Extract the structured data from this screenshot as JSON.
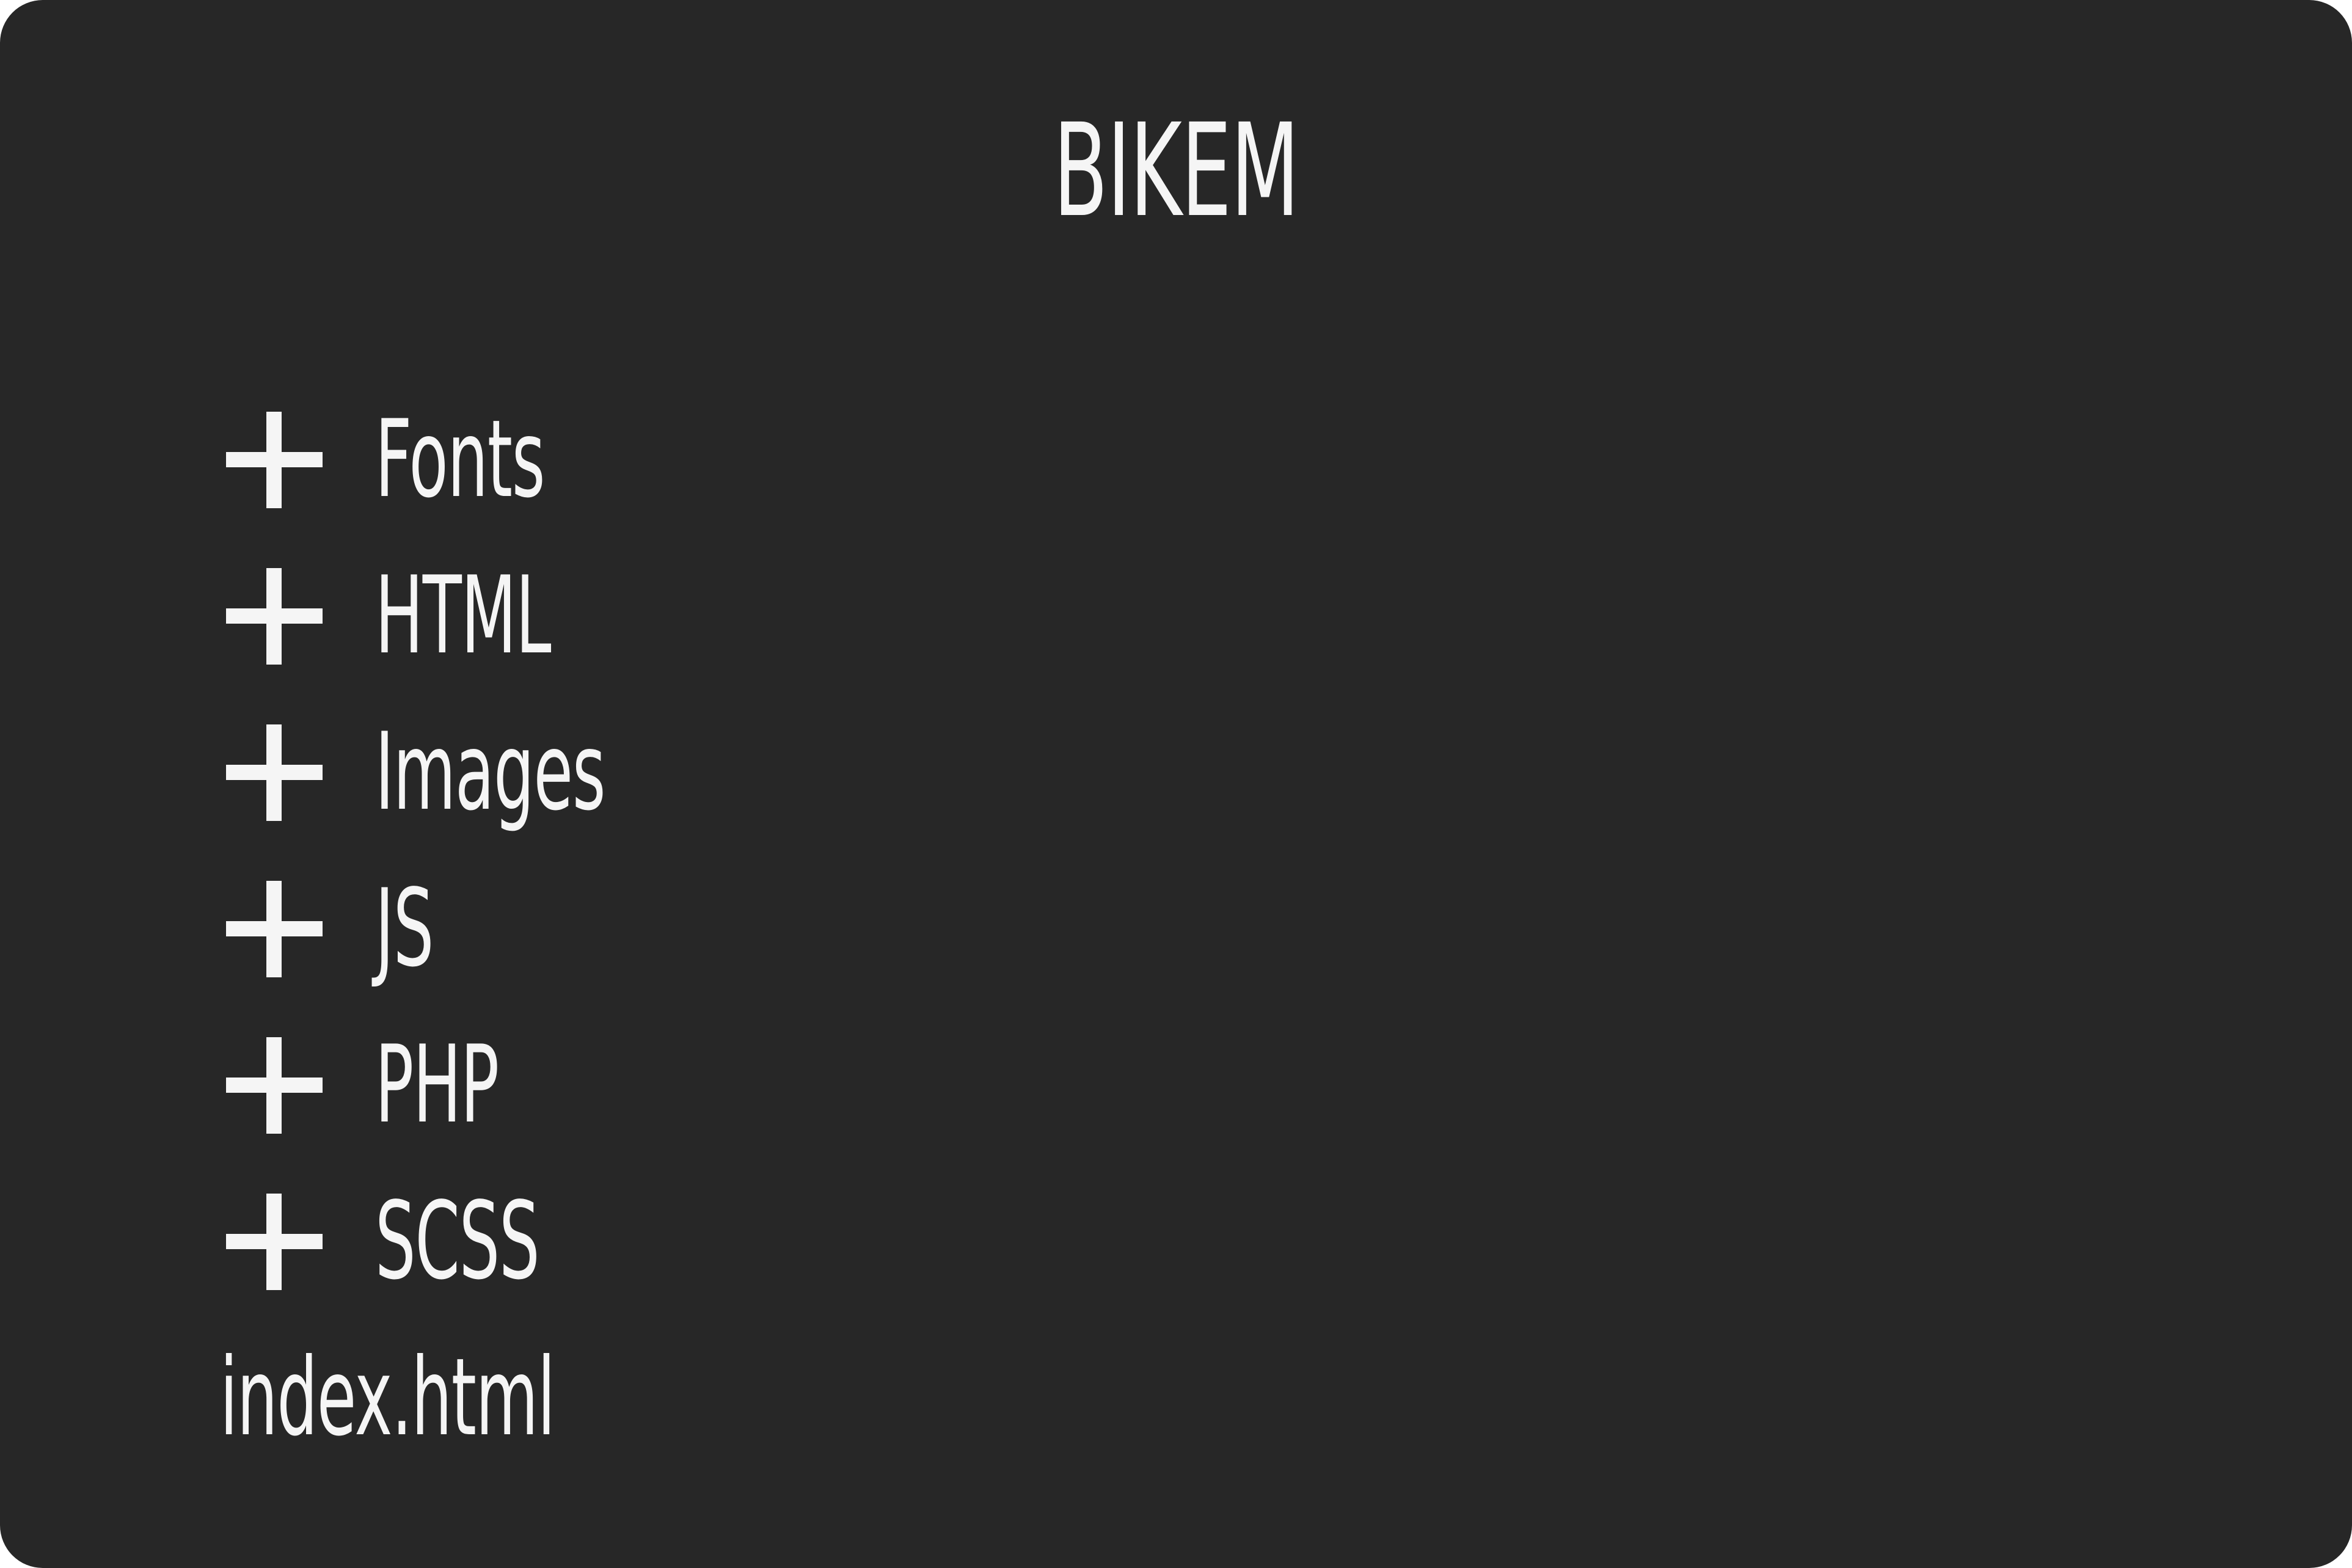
{
  "title": "BIKEM",
  "folders": [
    {
      "label": "Fonts",
      "icon": "plus-icon"
    },
    {
      "label": "HTML",
      "icon": "plus-icon"
    },
    {
      "label": "Images",
      "icon": "plus-icon"
    },
    {
      "label": "JS",
      "icon": "plus-icon"
    },
    {
      "label": "PHP",
      "icon": "plus-icon"
    },
    {
      "label": "SCSS",
      "icon": "plus-icon"
    }
  ],
  "files": [
    {
      "label": "index.html"
    }
  ],
  "colors": {
    "background": "#272727",
    "text": "#f5f5f5"
  }
}
